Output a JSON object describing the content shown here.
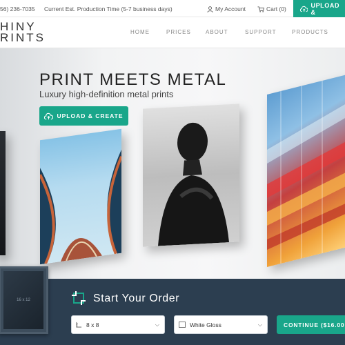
{
  "topbar": {
    "phone": "56) 236-7035",
    "production_time": "Current Est. Production Time (5-7 business days)",
    "account_label": "My Account",
    "cart_label": "Cart (0)",
    "upload_label": "UPLOAD &"
  },
  "nav": {
    "logo_line1": "HINY",
    "logo_line2": "RINTS",
    "links": [
      "HOME",
      "PRICES",
      "ABOUT",
      "SUPPORT",
      "PRODUCTS"
    ]
  },
  "hero": {
    "title": "PRINT MEETS METAL",
    "subtitle": "Luxury high-definition metal prints",
    "cta_label": "UPLOAD & CREATE"
  },
  "order": {
    "title": "Start Your Order",
    "thumb_size": "16 x 12",
    "size_value": "8 x 8",
    "finish_value": "White Gloss",
    "continue_label": "CONTINUE ($16.00"
  },
  "colors": {
    "accent": "#19a68a",
    "order_bar": "#2c3e50"
  }
}
